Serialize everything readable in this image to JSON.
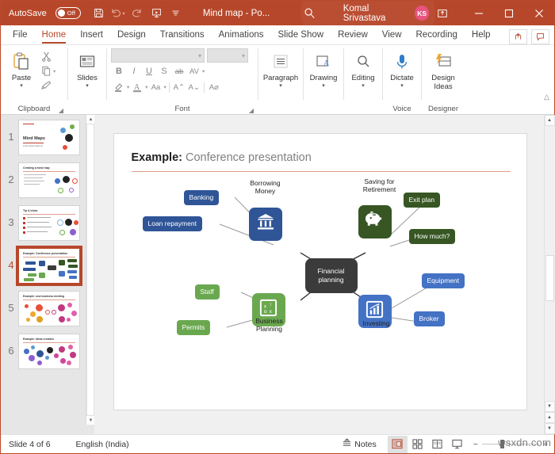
{
  "titlebar": {
    "autosave_label": "AutoSave",
    "autosave_state": "Off",
    "save_icon": "save-icon",
    "undo_icon": "undo-icon",
    "redo_icon": "redo-icon",
    "present_icon": "start-presentation-icon",
    "customize_icon": "customize-quick-access-icon",
    "document_title": "Mind map  -  Po...",
    "search_icon": "search-icon",
    "user_name": "Komal Srivastava",
    "user_initials": "KS",
    "ribbon_display_icon": "ribbon-display-options-icon",
    "minimize_icon": "minimize-icon",
    "maximize_icon": "maximize-icon",
    "close_icon": "close-icon",
    "bg_color": "#b7472a"
  },
  "tabs": [
    {
      "label": "File",
      "active": false
    },
    {
      "label": "Home",
      "active": true
    },
    {
      "label": "Insert",
      "active": false
    },
    {
      "label": "Design",
      "active": false
    },
    {
      "label": "Transitions",
      "active": false
    },
    {
      "label": "Animations",
      "active": false
    },
    {
      "label": "Slide Show",
      "active": false
    },
    {
      "label": "Review",
      "active": false
    },
    {
      "label": "View",
      "active": false
    },
    {
      "label": "Recording",
      "active": false
    },
    {
      "label": "Help",
      "active": false
    }
  ],
  "tabbar_right": [
    {
      "name": "share-button",
      "glyph": "↪"
    },
    {
      "name": "comments-button",
      "glyph": "❐"
    }
  ],
  "ribbon": {
    "groups": [
      {
        "label": "Clipboard",
        "has_dialog_launcher": true
      },
      {
        "label": "",
        "has_dialog_launcher": false
      },
      {
        "label": "Font",
        "has_dialog_launcher": true
      },
      {
        "label": "",
        "has_dialog_launcher": false
      },
      {
        "label": "",
        "has_dialog_launcher": false
      },
      {
        "label": "",
        "has_dialog_launcher": false
      },
      {
        "label": "Voice",
        "has_dialog_launcher": false
      },
      {
        "label": "Designer",
        "has_dialog_launcher": false
      }
    ],
    "paste_label": "Paste",
    "cut_label": "cut-icon",
    "copy_label": "copy-icon",
    "format_painter_label": "format-painter-icon",
    "slides_label": "Slides",
    "font_name_value": "",
    "font_size_value": "",
    "font_buttons": [
      "B",
      "I",
      "U",
      "S",
      "ab",
      "AV"
    ],
    "font_buttons_row2": [
      "✎",
      "A",
      "Aa",
      "A⌃",
      "A⌄",
      "A⌀"
    ],
    "paragraph_label": "Paragraph",
    "drawing_label": "Drawing",
    "editing_label": "Editing",
    "dictate_label": "Dictate",
    "design_ideas_label": "Design Ideas",
    "collapse_ribbon_icon": "collapse-ribbon-icon"
  },
  "thumbnails": {
    "slides": [
      {
        "number": "1",
        "selected": false,
        "title": "Mind Maps"
      },
      {
        "number": "2",
        "selected": false,
        "title": "Creating a mind map"
      },
      {
        "number": "3",
        "selected": false,
        "title": "Tip & tricks"
      },
      {
        "number": "4",
        "selected": true,
        "title": "Example: Conference presentation"
      },
      {
        "number": "5",
        "selected": false,
        "title": "Example: new business meeting"
      },
      {
        "number": "6",
        "selected": false,
        "title": "Example: Ideas creation"
      }
    ],
    "scroll_up_icon": "scroll-up-icon",
    "scroll_down_icon": "scroll-down-icon"
  },
  "slide": {
    "title_bold": "Example:",
    "title_rest": " Conference presentation",
    "rule_color": "#e0a08c",
    "center_node": {
      "label": "Financial\nplanning",
      "color": "#3b3b3b"
    },
    "branches": [
      {
        "name": "borrowing-money",
        "label": "Borrowing\nMoney",
        "icon": "bank-icon",
        "color": "#2f5597",
        "children": [
          {
            "label": "Banking",
            "color": "#2f5597"
          },
          {
            "label": "Loan repayment",
            "color": "#2f5597"
          }
        ]
      },
      {
        "name": "saving-for-retirement",
        "label": "Saving for\nRetirement",
        "icon": "piggy-bank-icon",
        "color": "#375623",
        "children": [
          {
            "label": "Exit plan",
            "color": "#375623"
          },
          {
            "label": "How much?",
            "color": "#375623"
          }
        ]
      },
      {
        "name": "business-planning",
        "label": "Business\nPlanning",
        "icon": "strategy-board-icon",
        "color": "#6aa84f",
        "children": [
          {
            "label": "Staff",
            "color": "#6aa84f"
          },
          {
            "label": "Permits",
            "color": "#6aa84f"
          }
        ]
      },
      {
        "name": "investing",
        "label": "Investing",
        "icon": "bar-chart-icon",
        "color": "#4472c4",
        "children": [
          {
            "label": "Equipment",
            "color": "#4472c4"
          },
          {
            "label": "Broker",
            "color": "#4472c4"
          }
        ]
      }
    ]
  },
  "statusbar": {
    "slide_count_text": "Slide 4 of 6",
    "language": "English (India)",
    "notes_label": "Notes",
    "views": [
      {
        "name": "normal-view-button",
        "active": true
      },
      {
        "name": "slide-sorter-view-button",
        "active": false
      },
      {
        "name": "reading-view-button",
        "active": false
      },
      {
        "name": "slideshow-view-button",
        "active": false
      }
    ],
    "zoom_out_label": "−",
    "zoom_in_label": "+",
    "watermark": "wsxdn.com"
  }
}
